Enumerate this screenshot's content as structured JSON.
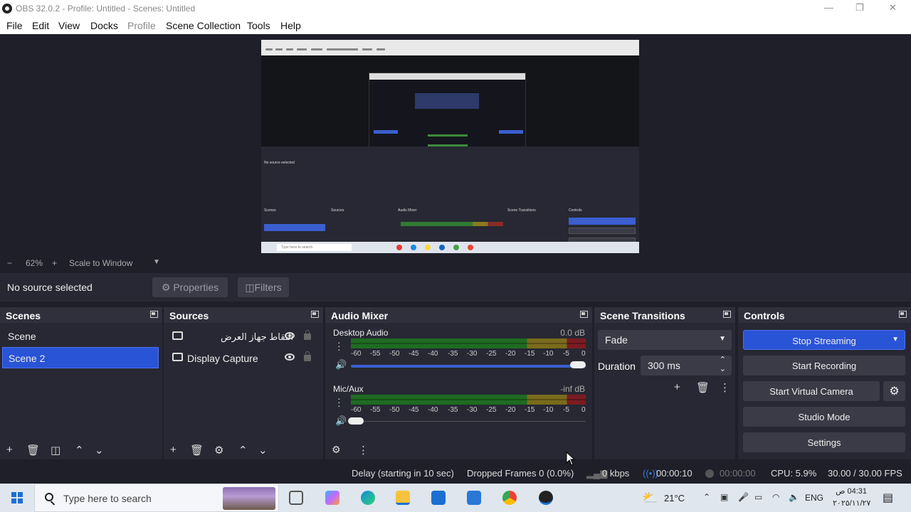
{
  "window": {
    "title": "OBS 32.0.2 - Profile: Untitled - Scenes: Untitled"
  },
  "menu": [
    "File",
    "Edit",
    "View",
    "Docks",
    "Profile",
    "Scene Collection",
    "Tools",
    "Help"
  ],
  "zoom": {
    "level": "62%",
    "mode": "Scale to Window"
  },
  "source_bar": {
    "status": "No source selected",
    "properties": "Properties",
    "filters": "Filters"
  },
  "docks": {
    "scenes": {
      "title": "Scenes",
      "items": [
        "Scene",
        "Scene 2"
      ],
      "selected": 1
    },
    "sources": {
      "title": "Sources",
      "items": [
        {
          "name": "التقاط جهاز العرض"
        },
        {
          "name": "Display Capture"
        }
      ]
    },
    "mixer": {
      "title": "Audio Mixer",
      "channels": [
        {
          "name": "Desktop Audio",
          "level": "0.0 dB",
          "volume": 1.0
        },
        {
          "name": "Mic/Aux",
          "level": "-inf dB",
          "volume": 0.0
        }
      ],
      "scale": [
        "-60",
        "-55",
        "-50",
        "-45",
        "-40",
        "-35",
        "-30",
        "-25",
        "-20",
        "-15",
        "-10",
        "-5",
        "0"
      ]
    },
    "transitions": {
      "title": "Scene Transitions",
      "transition": "Fade",
      "duration_label": "Duration",
      "duration": "300 ms"
    },
    "controls": {
      "title": "Controls",
      "stop_streaming": "Stop Streaming",
      "start_recording": "Start Recording",
      "start_virtual_camera": "Start Virtual Camera",
      "studio_mode": "Studio Mode",
      "settings": "Settings"
    }
  },
  "status": {
    "delay": "Delay (starting in 10 sec)",
    "dropped": "Dropped Frames 0 (0.0%)",
    "bitrate": "0 kbps",
    "stream_time": "00:00:10",
    "rec_time": "00:00:00",
    "cpu": "CPU: 5.9%",
    "fps": "30.00 / 30.00 FPS"
  },
  "taskbar": {
    "search_placeholder": "Type here to search",
    "temperature": "21°C",
    "language": "ENG",
    "time": "04:31 ص",
    "date": "٢٠٢٥/١١/٢٧"
  },
  "colors": {
    "accent": "#2a54d6",
    "panel": "#272833",
    "background": "#1e1f29"
  }
}
